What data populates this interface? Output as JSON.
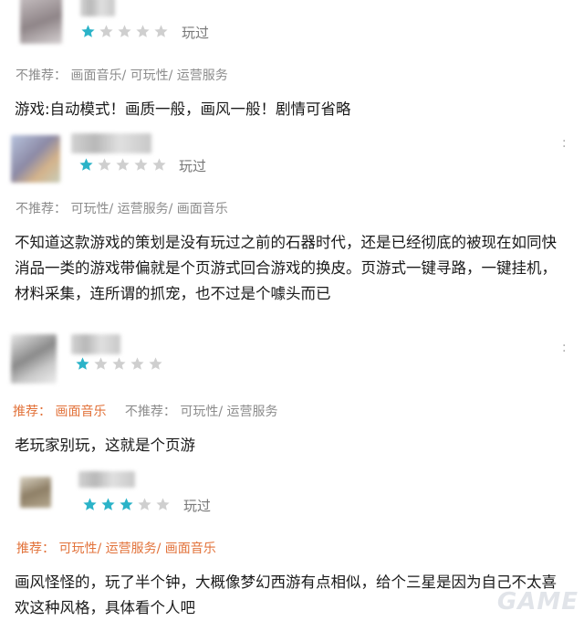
{
  "colors": {
    "star_on": "#2bb3c8",
    "star_off": "#cfcfcf",
    "tag_positive": "#e2723a",
    "tag_negative": "#8c8c8c"
  },
  "reviews": [
    {
      "rating": 1,
      "played": "玩过",
      "recommend_label": "",
      "recommend_tags": [],
      "not_recommend_label": "不推荐：",
      "not_recommend_tags": [
        "画面音乐/",
        "可玩性/",
        "运营服务"
      ],
      "text": "游戏:自动模式！画质一般，画风一般！剧情可省略"
    },
    {
      "rating": 1,
      "played": "玩过",
      "recommend_label": "",
      "recommend_tags": [],
      "not_recommend_label": "不推荐：",
      "not_recommend_tags": [
        "可玩性/",
        "运营服务/",
        "画面音乐"
      ],
      "text": "不知道这款游戏的策划是没有玩过之前的石器时代，还是已经彻底的被现在如同快消品一类的游戏带偏就是个页游式回合游戏的换皮。页游式一键寻路，一键挂机，材料采集，连所谓的抓宠，也不过是个噱头而已"
    },
    {
      "rating": 1,
      "played": "",
      "recommend_label": "推荐：",
      "recommend_tags": [
        "画面音乐"
      ],
      "not_recommend_label": "不推荐：",
      "not_recommend_tags": [
        "可玩性/",
        "运营服务"
      ],
      "text": "老玩家别玩，这就是个页游"
    },
    {
      "rating": 3,
      "played": "玩过",
      "recommend_label": "推荐：",
      "recommend_tags": [
        "可玩性/",
        "运营服务/",
        "画面音乐"
      ],
      "not_recommend_label": "",
      "not_recommend_tags": [],
      "text": "画风怪怪的，玩了半个钟，大概像梦幻西游有点相似，给个三星是因为自己不太喜欢这种风格，具体看个人吧"
    }
  ]
}
